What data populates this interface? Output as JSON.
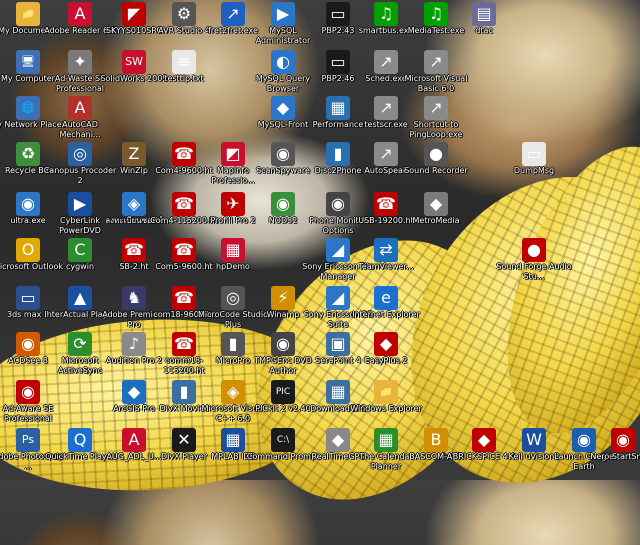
{
  "icons": [
    {
      "label": "My Documents",
      "glyph": "📁",
      "color": "#e7b53a"
    },
    {
      "label": "Adobe Reader 6.0",
      "glyph": "A",
      "color": "#c8102e"
    },
    {
      "label": "SKYYS010SRC",
      "glyph": "◤",
      "color": "#c00000"
    },
    {
      "label": "AVR Studio 4",
      "glyph": "⚙",
      "color": "#555555"
    },
    {
      "label": "fret2fret.exe",
      "glyph": "↗",
      "color": "#1f5fbf"
    },
    {
      "label": "MySQL Administrator",
      "glyph": "▶",
      "color": "#2a77c9"
    },
    {
      "label": "PBP2.43",
      "glyph": "▭",
      "color": "#1a1a1a"
    },
    {
      "label": "smartbus.exe",
      "glyph": "♫",
      "color": "#00a000"
    },
    {
      "label": "MediaTest.exe",
      "glyph": "♫",
      "color": "#00a000"
    },
    {
      "label": "dtac",
      "glyph": "▤",
      "color": "#6a6a9a"
    },
    {
      "label": "My Computer",
      "glyph": "🖥",
      "color": "#3d6fb5"
    },
    {
      "label": "Ad-Waste SE Professional",
      "glyph": "✦",
      "color": "#7a7a7a"
    },
    {
      "label": "SolidWorks 2005",
      "glyph": "SW",
      "color": "#c8102e"
    },
    {
      "label": "testtip.txt",
      "glyph": "≡",
      "color": "#e8e8e8"
    },
    {
      "label": "MySQL Query Browser",
      "glyph": "◐",
      "color": "#2a77c9"
    },
    {
      "label": "PBP2.46",
      "glyph": "▭",
      "color": "#1a1a1a"
    },
    {
      "label": "Sched.exe",
      "glyph": "↗",
      "color": "#8a8a8a"
    },
    {
      "label": "Microsoft Visual Basic 6.0",
      "glyph": "↗",
      "color": "#8a8a8a"
    },
    {
      "label": "My Network Places",
      "glyph": "🌐",
      "color": "#3d6fb5"
    },
    {
      "label": "AutoCAD Mechani...",
      "glyph": "A",
      "color": "#b0302a"
    },
    {
      "label": "MySQL-Front",
      "glyph": "◆",
      "color": "#2a77c9"
    },
    {
      "label": "Performance",
      "glyph": "▦",
      "color": "#2a6fb0"
    },
    {
      "label": "testscr.exe",
      "glyph": "↗",
      "color": "#8a8a8a"
    },
    {
      "label": "Shortcut to PingLoop.exe",
      "glyph": "↗",
      "color": "#8a8a8a"
    },
    {
      "label": "Recycle Bin",
      "glyph": "♻",
      "color": "#3d8f3d"
    },
    {
      "label": "Canopus Procoder 2",
      "glyph": "◎",
      "color": "#2a5fa0"
    },
    {
      "label": "WinZip",
      "glyph": "Z",
      "color": "#7a5a2a"
    },
    {
      "label": "Com4-9600.ht",
      "glyph": "☎",
      "color": "#c00000"
    },
    {
      "label": "MapInfo Professio...",
      "glyph": "◩",
      "color": "#c8102e"
    },
    {
      "label": "ScanSpyware",
      "glyph": "◉",
      "color": "#555555"
    },
    {
      "label": "Disc2Phone",
      "glyph": "▮",
      "color": "#2a6fb0"
    },
    {
      "label": "AutoSpeak",
      "glyph": "↗",
      "color": "#8a8a8a"
    },
    {
      "label": "Sound Recorder",
      "glyph": "●",
      "color": "#555555"
    },
    {
      "label": "DumpMsg",
      "glyph": "▭",
      "color": "#e8e8e8"
    },
    {
      "label": "ultra.exe",
      "glyph": "◉",
      "color": "#2a77c9"
    },
    {
      "label": "CyberLink PowerDVD",
      "glyph": "▶",
      "color": "#1a4fa0"
    },
    {
      "label": "ลงทะเบียนซอฟต์",
      "glyph": "◈",
      "color": "#2a77c9"
    },
    {
      "label": "Com4-115200.ht",
      "glyph": "☎",
      "color": "#c00000"
    },
    {
      "label": "Profili Pro 2",
      "glyph": "✈",
      "color": "#c00000"
    },
    {
      "label": "NOD32",
      "glyph": "◉",
      "color": "#3a8f3a"
    },
    {
      "label": "Phone Monitor Options",
      "glyph": "◉",
      "color": "#444444"
    },
    {
      "label": "USB-19200.ht",
      "glyph": "☎",
      "color": "#c00000"
    },
    {
      "label": "MetroMedia",
      "glyph": "◆",
      "color": "#7a7a7a"
    },
    {
      "label": "Microsoft Outlook",
      "glyph": "O",
      "color": "#e0a800"
    },
    {
      "label": "cygwin",
      "glyph": "C",
      "color": "#2a8f2a"
    },
    {
      "label": "SB-2.ht",
      "glyph": "☎",
      "color": "#c00000"
    },
    {
      "label": "Com5-9600.ht",
      "glyph": "☎",
      "color": "#c00000"
    },
    {
      "label": "hpDemo",
      "glyph": "▦",
      "color": "#c8102e"
    },
    {
      "label": "Sony Ericsson File Manager",
      "glyph": "◢",
      "color": "#2a77c9"
    },
    {
      "label": "TeamViewer...",
      "glyph": "⇄",
      "color": "#1a6fc0"
    },
    {
      "label": "Sound Forge Audio Stu...",
      "glyph": "●",
      "color": "#c00000"
    },
    {
      "label": "3ds max 7",
      "glyph": "▭",
      "color": "#2a4f8f"
    },
    {
      "label": "InterActual Player",
      "glyph": "▲",
      "color": "#1a4fa0"
    },
    {
      "label": "Adobe Premiere Pro",
      "glyph": "♞",
      "color": "#3a3a6a"
    },
    {
      "label": "com18-9600.ht",
      "glyph": "☎",
      "color": "#c00000"
    },
    {
      "label": "MicroCode Studio Plus",
      "glyph": "◎",
      "color": "#555555"
    },
    {
      "label": "Winamp",
      "glyph": "⚡",
      "color": "#d09000"
    },
    {
      "label": "Sony Ericsson PC Suite",
      "glyph": "◢",
      "color": "#2a77c9"
    },
    {
      "label": "Internet Explorer",
      "glyph": "e",
      "color": "#1a6fd0"
    },
    {
      "label": "ACDSee 8",
      "glyph": "◉",
      "color": "#d05a00"
    },
    {
      "label": "Microsoft ActiveSync",
      "glyph": "⟳",
      "color": "#2a8f2a"
    },
    {
      "label": "Audition Pro 2",
      "glyph": "♪",
      "color": "#8a8a8a"
    },
    {
      "label": "comm18-115200.ht",
      "glyph": "☎",
      "color": "#c00000"
    },
    {
      "label": "MicroPro",
      "glyph": "▮",
      "color": "#555555"
    },
    {
      "label": "TMPGEnc DVD Author",
      "glyph": "◉",
      "color": "#444444"
    },
    {
      "label": "SeraPoint 4",
      "glyph": "▣",
      "color": "#3a6fa0"
    },
    {
      "label": "EasyPlus 2",
      "glyph": "◆",
      "color": "#c00000"
    },
    {
      "label": "Ad-Aware SE Professional",
      "glyph": "◉",
      "color": "#c00000"
    },
    {
      "label": "ArcGIS Pro",
      "glyph": "◆",
      "color": "#1a6fc0"
    },
    {
      "label": "DivX Movies",
      "glyph": "▮",
      "color": "#3a6fa0"
    },
    {
      "label": "Microsoft Visual C++ 6.0",
      "glyph": "◈",
      "color": "#d09000"
    },
    {
      "label": "PICkit 2 v2.40",
      "glyph": "PIC",
      "color": "#1a1a1a"
    },
    {
      "label": "DownloadGPS",
      "glyph": "▦",
      "color": "#3a6fa0"
    },
    {
      "label": "Windows Explorer",
      "glyph": "📁",
      "color": "#e7b53a"
    },
    {
      "label": "Adobe Photoshop ...",
      "glyph": "Ps",
      "color": "#2a5fa0"
    },
    {
      "label": "QuickTime Player",
      "glyph": "Q",
      "color": "#1a6fd0"
    },
    {
      "label": "AUG_ADL_U...",
      "glyph": "A",
      "color": "#c8102e"
    },
    {
      "label": "DivX Player",
      "glyph": "✕",
      "color": "#1a1a1a"
    },
    {
      "label": "MPLAB IDE",
      "glyph": "▦",
      "color": "#1a4fa0"
    },
    {
      "label": "Command Prompt",
      "glyph": "C:\\",
      "color": "#1a1a1a"
    },
    {
      "label": "RealTimeGPS",
      "glyph": "◆",
      "color": "#888888"
    },
    {
      "label": "The Calendar Planner",
      "glyph": "▦",
      "color": "#2a8f2a"
    },
    {
      "label": "BASCOM-AVR",
      "glyph": "B",
      "color": "#d09000"
    },
    {
      "label": "BRICKSPICE 4.4",
      "glyph": "◆",
      "color": "#c00000"
    },
    {
      "label": "Keil uVision3",
      "glyph": "W",
      "color": "#1a4fa0"
    },
    {
      "label": "Launch Google Earth",
      "glyph": "◉",
      "color": "#1a5fb0"
    },
    {
      "label": "Nero StartSmart",
      "glyph": "◉",
      "color": "#c00000"
    }
  ]
}
